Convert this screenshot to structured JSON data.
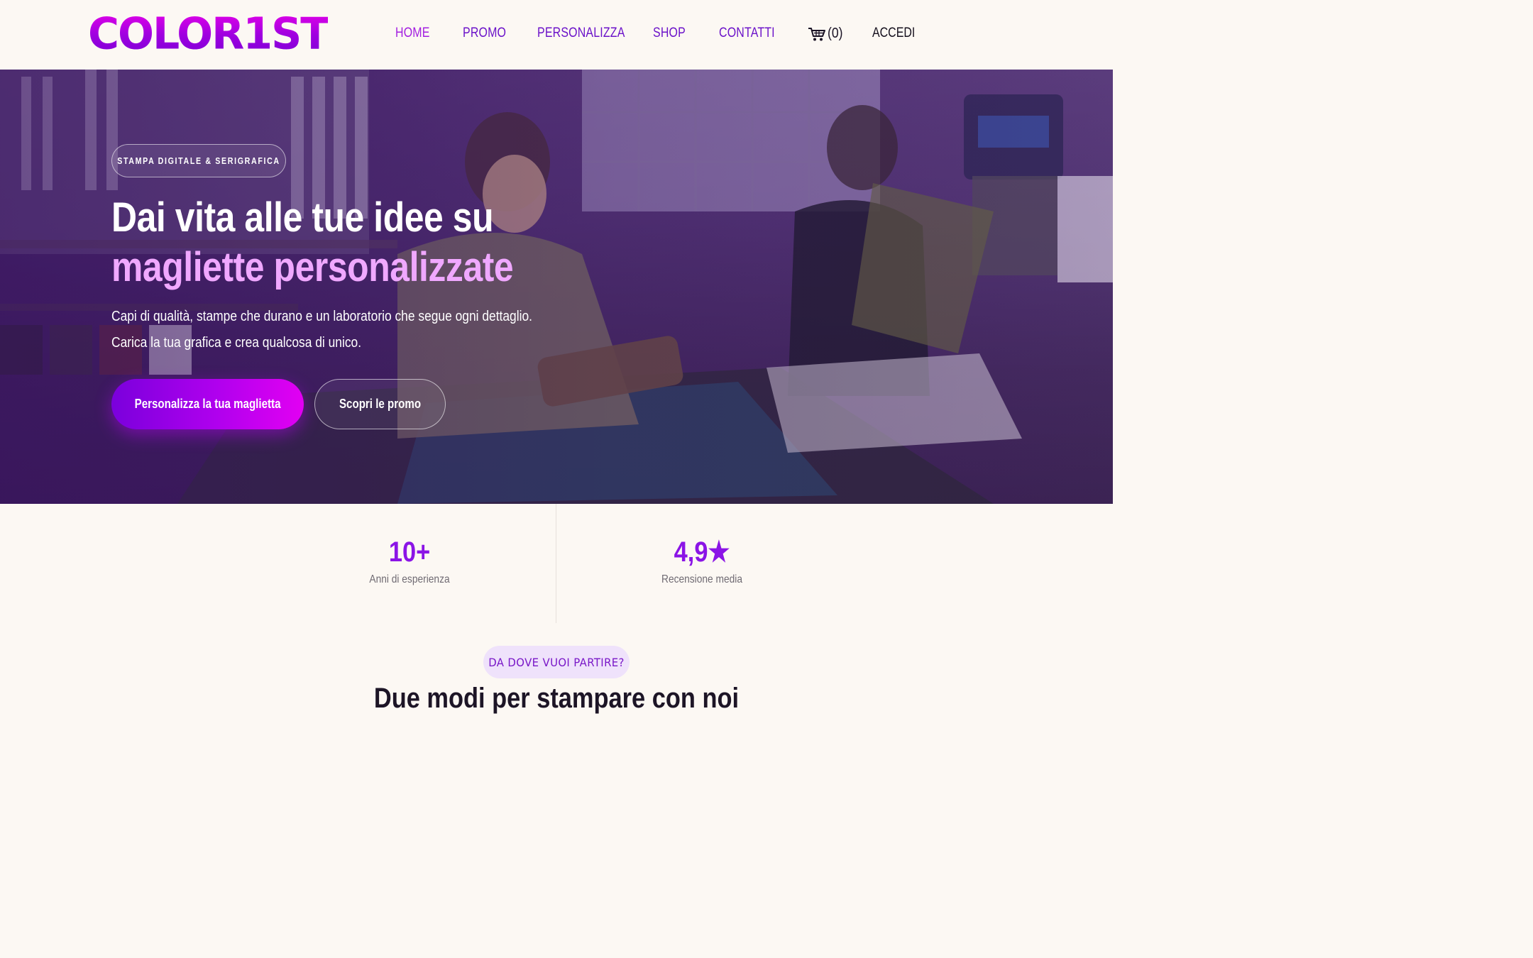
{
  "brand": {
    "logo_text": "COLOR1ST"
  },
  "nav": {
    "items": [
      {
        "label": "HOME",
        "active": true
      },
      {
        "label": "PROMO",
        "active": false
      },
      {
        "label": "PERSONALIZZA",
        "active": false
      },
      {
        "label": "SHOP",
        "active": false
      },
      {
        "label": "CONTATTI",
        "active": false
      }
    ],
    "cart_count": "(0)",
    "login_label": "ACCEDI"
  },
  "hero": {
    "badge": "STAMPA DIGITALE & SERIGRAFICA",
    "title_plain": "Dai vita alle tue idee su ",
    "title_accent": "magliette personalizzate",
    "subtitle": "Capi di qualità, stampe che durano e un laboratorio che segue ogni dettaglio. Carica la tua grafica e crea qualcosa di unico.",
    "primary_cta": "Personalizza la tua maglietta",
    "secondary_cta": "Scopri le promo"
  },
  "stats": [
    {
      "value": "10+",
      "label": "Anni di esperienza"
    },
    {
      "value": "4,9★",
      "label": "Recensione media"
    }
  ],
  "section": {
    "eyebrow": "DA DOVE VUOI PARTIRE?",
    "title": "Due modi per stampare con noi"
  },
  "colors": {
    "accent": "#8b14e6",
    "accent_light": "#f0a8ff",
    "nav_text": "#6b12c9",
    "background": "#fcf8f3"
  }
}
